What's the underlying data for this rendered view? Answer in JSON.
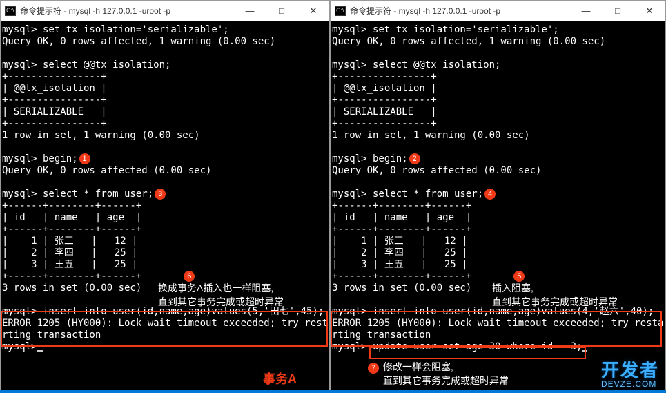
{
  "window_title": "命令提示符 - mysql  -h 127.0.0.1 -uroot -p",
  "win_controls": {
    "min": "—",
    "max": "□",
    "close": "✕"
  },
  "left": {
    "l1": "mysql> set tx_isolation='serializable';",
    "l2": "Query OK, 0 rows affected, 1 warning (0.00 sec)",
    "l3": "",
    "l4": "mysql> select @@tx_isolation;",
    "l5": "+----------------+",
    "l6": "| @@tx_isolation |",
    "l7": "+----------------+",
    "l8": "| SERIALIZABLE   |",
    "l9": "+----------------+",
    "l10": "1 row in set, 1 warning (0.00 sec)",
    "l11": "",
    "l12": "mysql> begin;",
    "l13": "Query OK, 0 rows affected (0.00 sec)",
    "l14": "",
    "l15": "mysql> select * from user;",
    "l16": "+------+--------+------+",
    "l17": "| id   | name   | age  |",
    "l18": "+------+--------+------+",
    "l19": "|    1 | 张三   |   12 |",
    "l20": "|    2 | 李四   |   25 |",
    "l21": "|    3 | 王五   |   25 |",
    "l22": "+------+--------+------+",
    "l23": "3 rows in set (0.00 sec)",
    "l24": "",
    "l25": "mysql> insert into user(id,name,age)values(5,'田七',45);",
    "l26": "ERROR 1205 (HY000): Lock wait timeout exceeded; try resta",
    "l27": "rting transaction",
    "l28": "mysql>"
  },
  "right": {
    "l1": "mysql> set tx_isolation='serializable';",
    "l2": "Query OK, 0 rows affected, 1 warning (0.00 sec)",
    "l3": "",
    "l4": "mysql> select @@tx_isolation;",
    "l5": "+----------------+",
    "l6": "| @@tx_isolation |",
    "l7": "+----------------+",
    "l8": "| SERIALIZABLE   |",
    "l9": "+----------------+",
    "l10": "1 row in set, 1 warning (0.00 sec)",
    "l11": "",
    "l12": "mysql> begin;",
    "l13": "Query OK, 0 rows affected (0.00 sec)",
    "l14": "",
    "l15": "mysql> select * from user;",
    "l16": "+------+--------+------+",
    "l17": "| id   | name   | age  |",
    "l18": "+------+--------+------+",
    "l19": "|    1 | 张三   |   12 |",
    "l20": "|    2 | 李四   |   25 |",
    "l21": "|    3 | 王五   |   25 |",
    "l22": "+------+--------+------+",
    "l23": "3 rows in set (0.00 sec)",
    "l24": "",
    "l25": "mysql> insert into user(id,name,age)values(4,'赵六',40);",
    "l26": "ERROR 1205 (HY000): Lock wait timeout exceeded; try resta",
    "l27": "rting transaction",
    "l28": "mysql> update user set age=30 where id = 3;"
  },
  "bubbles": {
    "b1": "1",
    "b2": "2",
    "b3": "3",
    "b4": "4",
    "b5": "5",
    "b6": "6",
    "b7": "7"
  },
  "annotations": {
    "a6": "换成事务A插入也一样阻塞,\n直到其它事务完成或超时异常",
    "a5": "插入阻塞,\n直到其它事务完成或超时异常",
    "a7": "修改一样会阻塞,\n直到其它事务完成或超时异常",
    "txA": "事务A"
  },
  "watermark": {
    "top": "开发者",
    "sub": "DEVZE.COM"
  }
}
